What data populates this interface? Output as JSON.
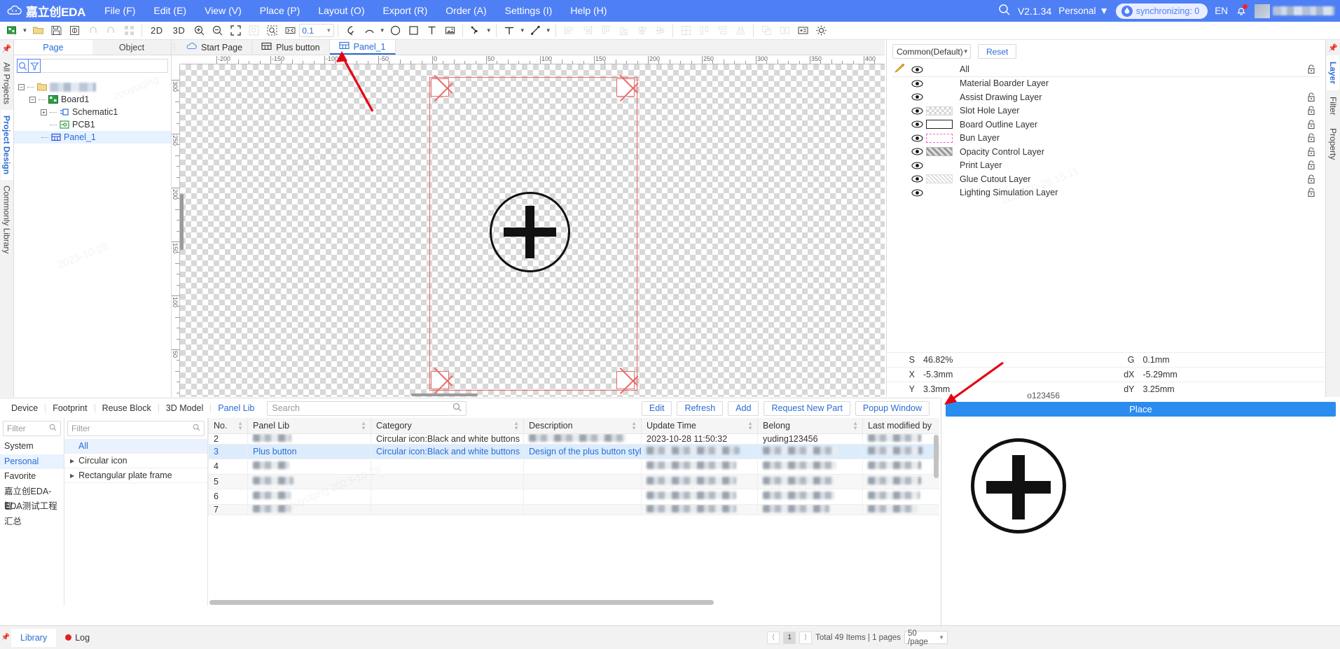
{
  "app": {
    "brand": "嘉立创EDA",
    "version": "V2.1.34",
    "account_label": "Personal",
    "sync_label": "synchronizing: 0",
    "language": "EN"
  },
  "menubar": {
    "items": [
      {
        "label": "File (F)"
      },
      {
        "label": "Edit (E)"
      },
      {
        "label": "View (V)"
      },
      {
        "label": "Place (P)"
      },
      {
        "label": "Layout (O)"
      },
      {
        "label": "Export (R)"
      },
      {
        "label": "Order (A)"
      },
      {
        "label": "Settings (I)"
      },
      {
        "label": "Help (H)"
      }
    ]
  },
  "toolbar": {
    "view_2d": "2D",
    "view_3d": "3D",
    "grid_value": "0.1"
  },
  "left_vtabs": [
    {
      "label": "All Projects",
      "active": false
    },
    {
      "label": "Project Design",
      "active": true
    },
    {
      "label": "Commonly Library",
      "active": false
    }
  ],
  "page_panel": {
    "tabs": [
      {
        "label": "Page",
        "active": true
      },
      {
        "label": "Object",
        "active": false
      }
    ],
    "search_value": "",
    "tree": [
      {
        "label": "",
        "blurred": true,
        "icon": "folder-icon",
        "depth": 0
      },
      {
        "label": "Board1",
        "icon": "board-icon",
        "depth": 1
      },
      {
        "label": "Schematic1",
        "icon": "schematic-icon",
        "depth": 2
      },
      {
        "label": "PCB1",
        "icon": "pcb-icon",
        "depth": 2
      },
      {
        "label": "Panel_1",
        "icon": "panel-icon",
        "depth": 2,
        "selected": true
      }
    ]
  },
  "canvas_tabs": [
    {
      "label": "Start Page",
      "icon": "cloud-icon",
      "active": false
    },
    {
      "label": "Plus button",
      "icon": "panel-icon",
      "active": false
    },
    {
      "label": "Panel_1",
      "icon": "panel-icon",
      "active": true
    }
  ],
  "canvas": {
    "ruler_h_labels": [
      "-200",
      "-150",
      "-100",
      "-50",
      "0",
      "50",
      "100",
      "150",
      "200",
      "250",
      "300",
      "350",
      "400"
    ],
    "ruler_v_labels": [
      "300",
      "250",
      "200",
      "150",
      "100",
      "50"
    ]
  },
  "layer_panel": {
    "profile_selected": "Common(Default)",
    "reset_label": "Reset",
    "side_tabs": [
      {
        "label": "Layer",
        "active": true
      },
      {
        "label": "Filter",
        "active": false
      },
      {
        "label": "Property",
        "active": false
      }
    ],
    "layers": [
      {
        "name": "All",
        "swatch": "none",
        "lock": true,
        "pencil": true
      },
      {
        "name": "Material Boarder Layer",
        "swatch": "none",
        "lock": false
      },
      {
        "name": "Assist Drawing Layer",
        "swatch": "none",
        "lock": true
      },
      {
        "name": "Slot Hole Layer",
        "swatch": "checker",
        "lock": true
      },
      {
        "name": "Board Outline Layer",
        "swatch": "outline",
        "lock": true
      },
      {
        "name": "Bun Layer",
        "swatch": "dashed-pink",
        "lock": true
      },
      {
        "name": "Opacity Control Layer",
        "swatch": "hatch",
        "lock": true
      },
      {
        "name": "Print Layer",
        "swatch": "none",
        "lock": true
      },
      {
        "name": "Glue Cutout Layer",
        "swatch": "cross",
        "lock": true
      },
      {
        "name": "Lighting Simulation Layer",
        "swatch": "none",
        "lock": true
      }
    ]
  },
  "status_values": {
    "rows": [
      {
        "k1": "S",
        "v1": "46.82%",
        "k2": "G",
        "v2": "0.1mm"
      },
      {
        "k1": "X",
        "v1": "-5.3mm",
        "k2": "dX",
        "v2": "-5.29mm"
      },
      {
        "k1": "Y",
        "v1": "3.3mm",
        "k2": "dY",
        "v2": "3.25mm"
      }
    ]
  },
  "library_panel": {
    "tabs": [
      {
        "label": "Device",
        "active": false
      },
      {
        "label": "Footprint",
        "active": false
      },
      {
        "label": "Reuse Block",
        "active": false
      },
      {
        "label": "3D Model",
        "active": false
      },
      {
        "label": "Panel Lib",
        "active": true
      }
    ],
    "search_placeholder": "Search",
    "search_value": "",
    "actions": [
      {
        "label": "Edit"
      },
      {
        "label": "Refresh"
      },
      {
        "label": "Add"
      },
      {
        "label": "Request New Part"
      },
      {
        "label": "Popup Window"
      }
    ],
    "category_filter_placeholder": "Filter",
    "categories": [
      {
        "label": "System",
        "active": false
      },
      {
        "label": "Personal",
        "active": true
      },
      {
        "label": "Favorite",
        "active": false
      },
      {
        "label": "嘉立创EDA-智...",
        "active": false
      },
      {
        "label": "EDA测试工程汇总",
        "active": false
      }
    ],
    "sub_filter_placeholder": "Filter",
    "subcategories": [
      {
        "label": "All",
        "active": true,
        "expandable": false
      },
      {
        "label": "Circular icon",
        "active": false,
        "expandable": true
      },
      {
        "label": "Rectangular plate frame",
        "active": false,
        "expandable": true
      }
    ],
    "table": {
      "columns": [
        "No.",
        "Panel Lib",
        "Category",
        "Description",
        "Update Time",
        "Belong",
        "Last modified by"
      ],
      "rows": [
        {
          "no": "2",
          "panel_lib": "",
          "category": "Circular icon:Black and white buttons",
          "description": "",
          "update_time": "2023-10-28 11:50:32",
          "belong": "yuding123456",
          "last_modified": "",
          "blur": true,
          "clipped": true
        },
        {
          "no": "3",
          "panel_lib": "Plus button",
          "category": "Circular icon:Black and white buttons",
          "description": "Design of the plus button style fo...",
          "update_time": "",
          "belong": "",
          "last_modified": "",
          "selected": true
        },
        {
          "no": "4",
          "panel_lib": "",
          "category": "",
          "description": "",
          "update_time": "",
          "belong": "",
          "last_modified": "",
          "blur": true
        },
        {
          "no": "5",
          "panel_lib": "",
          "category": "",
          "description": "",
          "update_time": "",
          "belong": "",
          "last_modified": "",
          "blur": true
        },
        {
          "no": "6",
          "panel_lib": "",
          "category": "",
          "description": "",
          "update_time": "",
          "belong": "",
          "last_modified": "",
          "blur": true
        },
        {
          "no": "7",
          "panel_lib": "",
          "category": "",
          "description": "",
          "update_time": "",
          "belong": "",
          "last_modified": "",
          "blur": true
        }
      ]
    }
  },
  "place_panel": {
    "place_label": "Place",
    "preview_caption": "o123456"
  },
  "statusbar": {
    "tabs": [
      {
        "label": "Library",
        "active": true
      },
      {
        "label": "Log",
        "active": false
      }
    ],
    "page_current": "1",
    "total_text": "Total 49 Items | 1 pages",
    "page_size": "50 /page"
  },
  "colors": {
    "brand_blue": "#4f7ff5",
    "link_blue": "#2b6cd4",
    "outline_red": "#e86b6b",
    "arrow_red": "#e60012",
    "place_blue": "#2b8cf0"
  }
}
